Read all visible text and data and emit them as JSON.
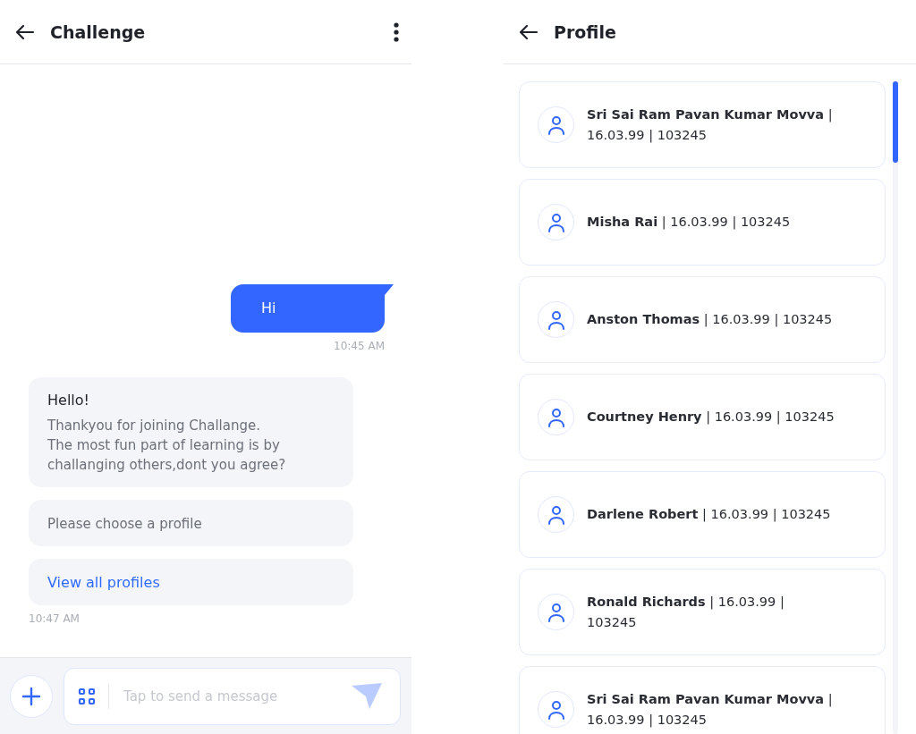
{
  "chat": {
    "title": "Challenge",
    "messages": [
      {
        "kind": "sent",
        "text": "Hi",
        "time": "10:45 AM"
      },
      {
        "kind": "received",
        "title": "Hello!",
        "text": "Thankyou for joining Challange.\nThe most fun part of learning is by\nchallanging others,dont you agree?"
      },
      {
        "kind": "received",
        "text": "Please choose a profile"
      },
      {
        "kind": "link",
        "text": "View all profiles",
        "time": "10:47 AM"
      }
    ],
    "composer": {
      "placeholder": "Tap to send a message"
    }
  },
  "profile": {
    "title": "Profile",
    "items": [
      {
        "text": "**Sri Sai Ram Pavan Kumar Movva** | 16.03.99 | 103245"
      },
      {
        "text": "**Misha Rai** | 16.03.99 | 103245"
      },
      {
        "text": "**Anston Thomas** | 16.03.99 | 103245"
      },
      {
        "text": "**Courtney Henry** | 16.03.99 | 103245"
      },
      {
        "text": "**Darlene Robert** | 16.03.99 | 103245"
      },
      {
        "text": "**Ronald Richards** | 16.03.99 | 103245"
      },
      {
        "text": "**Sri Sai Ram Pavan Kumar Movva** | 16.03.99 | 103245"
      }
    ]
  }
}
